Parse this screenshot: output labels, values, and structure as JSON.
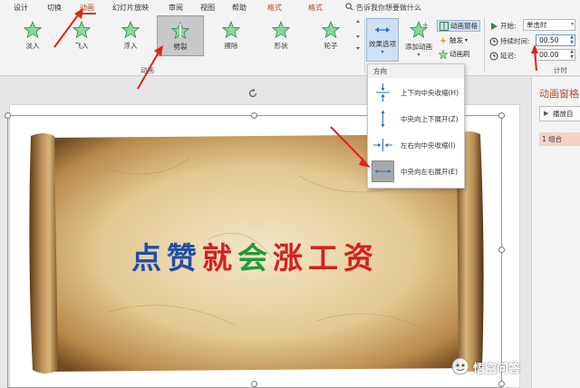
{
  "tabs": [
    "设计",
    "切换",
    "动画",
    "幻灯片放映",
    "审阅",
    "视图",
    "帮助",
    "格式",
    "格式"
  ],
  "active_tab": "动画",
  "search": {
    "text": "告诉我你想要做什么"
  },
  "effects": [
    {
      "label": "淡入",
      "color": "#35a35a"
    },
    {
      "label": "飞入",
      "color": "#35a35a"
    },
    {
      "label": "浮入",
      "color": "#35a35a"
    },
    {
      "label": "劈裂",
      "color": "#35a35a"
    },
    {
      "label": "擦除",
      "color": "#35a35a"
    },
    {
      "label": "形状",
      "color": "#35a35a"
    },
    {
      "label": "轮子",
      "color": "#35a35a"
    }
  ],
  "effects_group_label": "动画",
  "effect_options_label": "效果选项",
  "add_animation_label": "添加动画",
  "anim_pane_label": "动画窗格",
  "trigger_label": "触发",
  "painter_label": "动画刷",
  "timing": {
    "start_label": "开始:",
    "start_value": "单击时",
    "duration_label": "持续时间:",
    "duration_value": "00.50",
    "delay_label": "延迟:",
    "delay_value": "00.00",
    "group_label": "计时"
  },
  "dropdown": {
    "header": "方向",
    "items": [
      {
        "label": "上下向中央收缩(H)",
        "icon": "vertical-in-icon"
      },
      {
        "label": "中央向上下展开(Z)",
        "icon": "vertical-out-icon"
      },
      {
        "label": "左右向中央收缩(I)",
        "icon": "horizontal-in-icon"
      },
      {
        "label": "中央向左右展开(E)",
        "icon": "horizontal-out-icon"
      }
    ],
    "selected": 3
  },
  "pane": {
    "title": "动画窗格",
    "play_label": "播放自",
    "item_label": "1 组合"
  },
  "slide_title": {
    "chars": [
      {
        "ch": "点",
        "color": "#1f4fa8"
      },
      {
        "ch": "赞",
        "color": "#1f4fa8"
      },
      {
        "ch": "就",
        "color": "#d42020"
      },
      {
        "ch": "会",
        "color": "#1f9a3a"
      },
      {
        "ch": "涨",
        "color": "#d42020"
      },
      {
        "ch": "工",
        "color": "#d42020"
      },
      {
        "ch": "资",
        "color": "#d42020"
      }
    ]
  },
  "watermark": "悟空问答",
  "accent_color": "#b7472a"
}
